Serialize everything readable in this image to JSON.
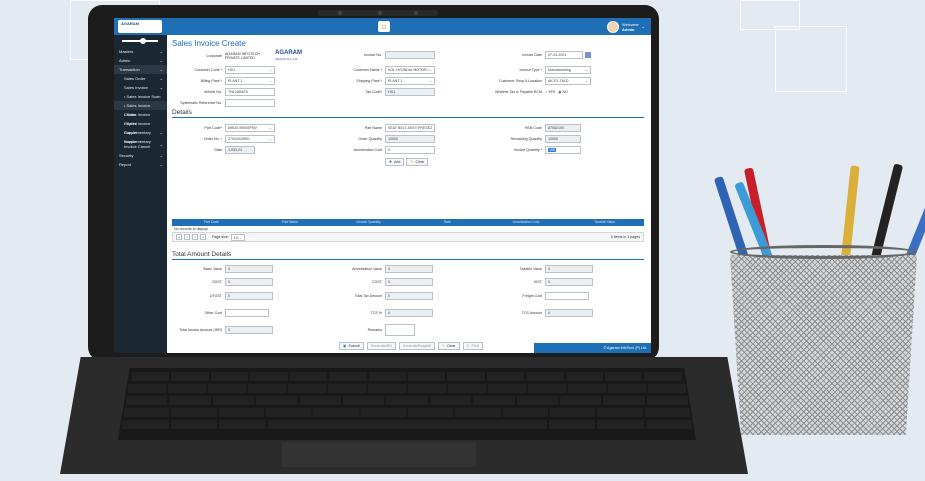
{
  "app": {
    "logo_text": "AGARAM",
    "welcome": "Welcome",
    "user": "Admin"
  },
  "sidebar": {
    "items": [
      {
        "label": "Masters",
        "arrow": "⌄"
      },
      {
        "label": "Admin",
        "arrow": "⌄"
      },
      {
        "label": "Transaction",
        "arrow": "⌄"
      },
      {
        "label": "Sales Order",
        "arrow": "⌄"
      },
      {
        "label": "Sales Invoice",
        "arrow": "⌄"
      },
      {
        "label": "• Sales Invoice Scan",
        "arrow": ""
      },
      {
        "label": "• Sales Invoice Create",
        "arrow": ""
      },
      {
        "label": "• Sales Invoice Reprint",
        "arrow": ""
      },
      {
        "label": "• Sales Invoice Cancel",
        "arrow": ""
      },
      {
        "label": "Supplementary Invoice",
        "arrow": "⌄"
      },
      {
        "label": "Supplementary Invoice Cancel",
        "arrow": "⌄"
      },
      {
        "label": "Security",
        "arrow": "⌄"
      },
      {
        "label": "Report",
        "arrow": "⌄"
      }
    ]
  },
  "page": {
    "title": "Sales Invoice Create"
  },
  "header_form": {
    "corporate_label": "Corporate",
    "corporate_value": "AGARAM INFOTECH PRIVATE LIMITED",
    "company_logo": "AGARAM",
    "company_logo_sub": "InfoTech Pvt. Ltd.",
    "invoice_no_label": "Invoice No.",
    "invoice_no_value": "",
    "invoice_date_label": "Invoice Date",
    "invoice_date_value": "07-04-2021",
    "customer_code_label": "Customer Code *",
    "customer_code_value": "HD1",
    "customer_name_label": "Customer Name *",
    "customer_name_value": "KOL HYUNDAI MOTOR I",
    "invoice_type_label": "Invoice Type *",
    "invoice_type_value": "Manufacturing",
    "billing_plant_label": "Billing Plant *",
    "billing_plant_value": "PLANT 1",
    "shipping_plant_label": "Shipping Plant *",
    "shipping_plant_value": "PLANT 1",
    "customer_shop_label": "Customer Shop & Location",
    "customer_shop_value": "AK-P1-TA1D",
    "vehicle_no_label": "Vehicle No.",
    "vehicle_no_value": "TN12AB878",
    "tax_code_label": "Tax Code*",
    "tax_code_value": "HD1",
    "rcm_label": "Whether Tax is Payable RCM",
    "rcm_yes": "YES",
    "rcm_no": "NO",
    "systematic_ref_label": "Systematic Reference No.",
    "systematic_ref_value": ""
  },
  "details": {
    "section_title": "Details",
    "part_code_label": "Part Code*",
    "part_code_value": "89920-99000PMV",
    "part_name_label": "Part Name",
    "part_name_value": "SEAT BELT ASSY-PRESET",
    "hsn_code_label": "HSN Code",
    "hsn_code_value": "87082100",
    "order_no_label": "Order No. *",
    "order_no_value": "27042020501",
    "order_qty_label": "Order Quantity",
    "order_qty_value": "10000",
    "remaining_qty_label": "Remaining Quantity",
    "remaining_qty_value": "10000",
    "rate_label": "Rate",
    "rate_value": "1,053.23",
    "amort_cost_label": "Amortization Cost",
    "amort_cost_value": "0",
    "invoice_qty_label": "Invoice Quantity *",
    "invoice_qty_value": "100",
    "add_button": "Add",
    "clear_button": "Clear"
  },
  "grid": {
    "columns": [
      "Part Code",
      "Part Name",
      "Invoice Quantity",
      "Rate",
      "Amortization Cost",
      "Taxable Value"
    ],
    "no_records": "No records to display.",
    "page_size_label": "Page size:",
    "page_size_value": "10",
    "page_info": "0 items in 1 pages",
    "first": "«",
    "prev": "‹",
    "next": "›",
    "last": "»"
  },
  "totals": {
    "section_title": "Total Amount Details",
    "basic_value_label": "Basic Value",
    "basic_value": "0",
    "amort_value_label": "Amortization Value",
    "amort_value": "0",
    "taxable_value_label": "Taxable Value",
    "taxable_value": "0",
    "sgst_label": "SGST",
    "sgst_value": "0",
    "cgst_label": "CGST",
    "cgst_value": "0",
    "igst_label": "IGST",
    "igst_value": "0",
    "utgst_label": "UTGST",
    "utgst_value": "0",
    "total_tax_label": "Total Tax Amount",
    "total_tax_value": "0",
    "freight_cost_label": "Freight Cost",
    "freight_cost_value": "",
    "other_cost_label": "Other Cost",
    "other_cost_value": "",
    "tcs_pct_label": "TCS %",
    "tcs_pct_value": "0",
    "tcs_amount_label": "TCS Amount",
    "tcs_amount_value": "0",
    "total_invoice_label": "Total Invoice Amount (INR)",
    "total_invoice_value": "0",
    "remarks_label": "Remarks",
    "remarks_value": ""
  },
  "actions": {
    "submit": "Submit",
    "generate_irn": "GenerateIRN",
    "generate_ewaybill": "GenerateEwaybill",
    "clear": "Clear",
    "print": "Print"
  },
  "footer": {
    "text": "© Agaram InfoTech (P) Ltd."
  },
  "colors": {
    "primary": "#1f6fb7",
    "sidebar": "#1b2733",
    "accent_orange": "#e07a1f"
  }
}
